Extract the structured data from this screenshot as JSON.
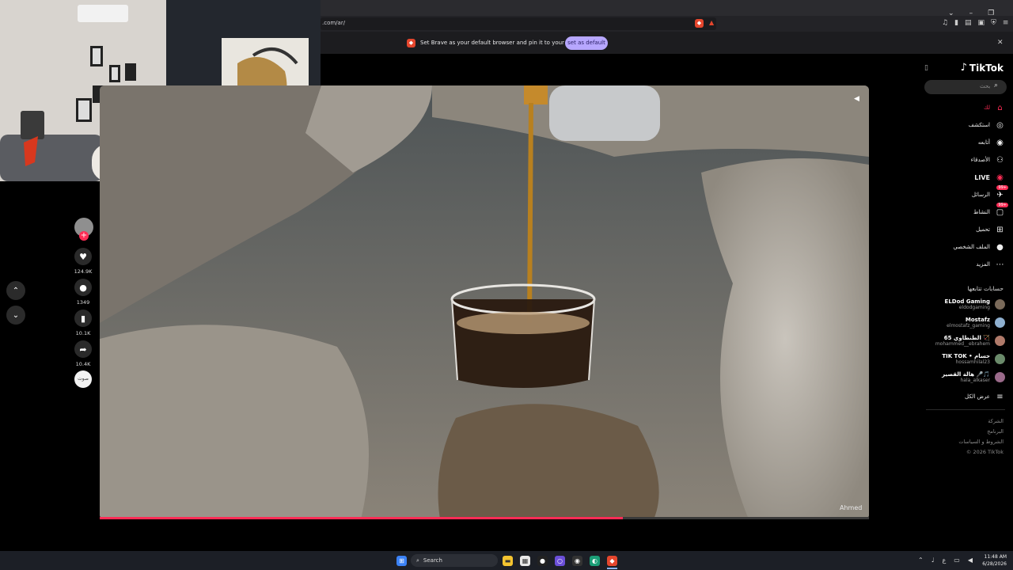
{
  "browser": {
    "url": ".com/ar/",
    "infobar_text": "Set Brave as your default browser and pin it to your taskbar",
    "set_default_label": "set as default",
    "close_label": "✕"
  },
  "tiktok": {
    "logo_text": "TikTok",
    "search_placeholder": "بحث",
    "nav": [
      {
        "label": "لك",
        "icon": "home-icon"
      },
      {
        "label": "استكشف",
        "icon": "compass-icon"
      },
      {
        "label": "أتابعه",
        "icon": "following-icon"
      },
      {
        "label": "الأصدقاء",
        "icon": "friends-icon"
      },
      {
        "label": "LIVE",
        "icon": "live-icon"
      },
      {
        "label": "الرسائل",
        "icon": "messages-icon",
        "badge": "99+"
      },
      {
        "label": "النشاط",
        "icon": "activity-icon",
        "badge": "99+"
      },
      {
        "label": "تحميل",
        "icon": "upload-icon"
      },
      {
        "label": "الملف الشخصي",
        "icon": "profile-icon"
      },
      {
        "label": "المزيد",
        "icon": "more-icon"
      }
    ],
    "following_title": "حسابات تتابعها",
    "following": [
      {
        "name": "ELDod Gaming",
        "handle": "eldodgaming"
      },
      {
        "name": "Mostafz",
        "handle": "elmostafz_gaming"
      },
      {
        "name": "الطنطاوي 65 🏹",
        "handle": "mohammed__ebrahem"
      },
      {
        "name": "TIK TOK • حسام",
        "handle": "hossamhilal23"
      },
      {
        "name": "هالة القصير 🎤🎵",
        "handle": "hala_alkaser"
      }
    ],
    "see_more": "عرض الكل",
    "footer": [
      "الشركة",
      "البرنامج",
      "الشروط و السياسات",
      "© 2026 TikTok"
    ]
  },
  "video": {
    "watermark": "Ahmed",
    "progress": 0.68
  },
  "actions": {
    "likes": "124.9K",
    "comments": "1349",
    "saves": "10.1K",
    "shares": "10.4K",
    "sound_label": "صوت"
  },
  "taskbar": {
    "search_label": "Search",
    "time": "11:48 AM",
    "date": "6/28/2026",
    "lang": "ع"
  },
  "colors": {
    "accent": "#fe2c55",
    "brave": "#e5462d",
    "set_default_bg": "#b7a7ff"
  }
}
